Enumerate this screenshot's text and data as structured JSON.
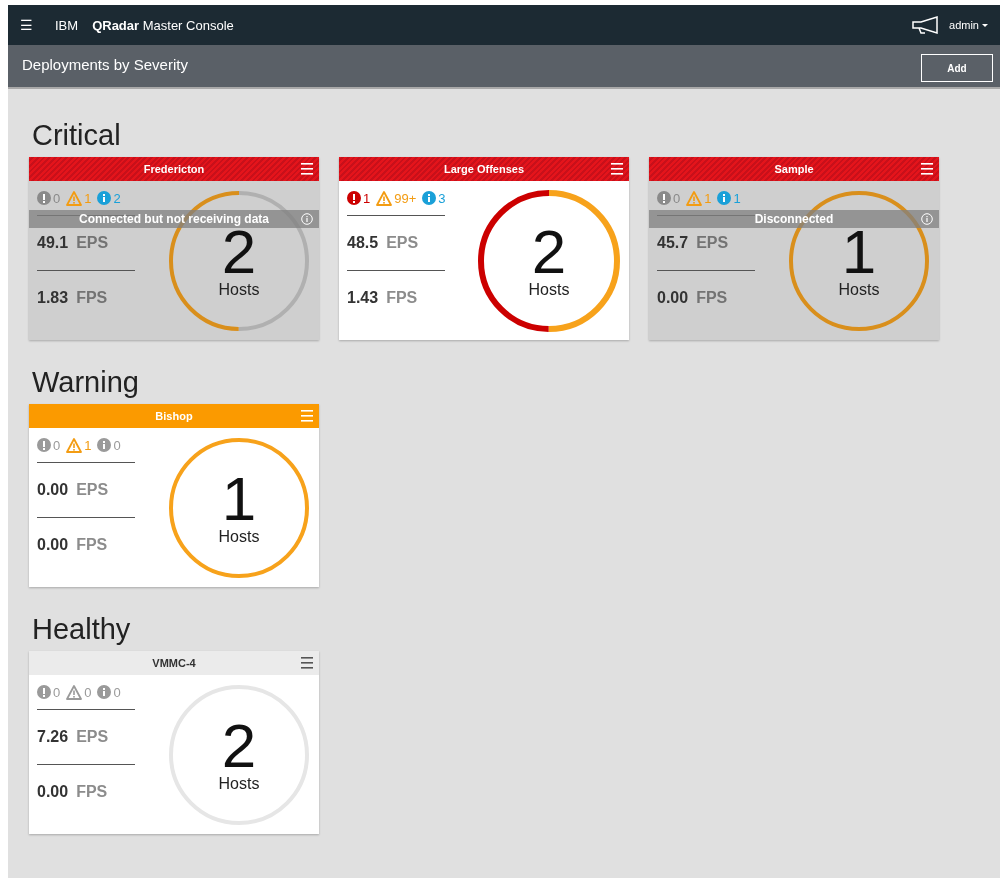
{
  "topbar": {
    "menu": "☰",
    "brand": "IBM",
    "product_bold": "QRadar",
    "product": "Master Console",
    "user": "admin"
  },
  "subheader": {
    "title": "Deployments by Severity",
    "button": "Add"
  },
  "sections": [
    {
      "title": "Critical",
      "deployments": [
        {
          "name": "Fredericton",
          "kind": "critical",
          "counts": [
            {
              "kind": "error",
              "value": "0",
              "active": false
            },
            {
              "kind": "warning",
              "value": "1",
              "active": true
            },
            {
              "kind": "info",
              "value": "2",
              "active": true
            }
          ],
          "status": "Connected but not receiving data",
          "eps": "49.1",
          "eps_label": "EPS",
          "fps": "1.83",
          "fps_label": "FPS",
          "hosts": "2",
          "hosts_label": "Hosts",
          "ring": [
            {
              "color": "#b0b0b0",
              "level": 0.5
            },
            {
              "color": "#d98f1c",
              "level": 0.5
            }
          ]
        },
        {
          "name": "Large Offenses",
          "kind": "critical",
          "counts": [
            {
              "kind": "error",
              "value": "1",
              "active": true
            },
            {
              "kind": "warning",
              "value": "99+",
              "active": true
            },
            {
              "kind": "info",
              "value": "3",
              "active": true
            }
          ],
          "eps": "48.5",
          "eps_label": "EPS",
          "fps": "1.43",
          "fps_label": "FPS",
          "hosts": "2",
          "hosts_label": "Hosts",
          "ring": [
            {
              "color": "#f7a21b",
              "level": 0.5
            },
            {
              "color": "#cc0000",
              "level": 0.5
            }
          ]
        },
        {
          "name": "Sample",
          "kind": "critical",
          "counts": [
            {
              "kind": "error",
              "value": "0",
              "active": false
            },
            {
              "kind": "warning",
              "value": "1",
              "active": true
            },
            {
              "kind": "info",
              "value": "1",
              "active": true
            }
          ],
          "status": "Disconnected",
          "eps": "45.7",
          "eps_label": "EPS",
          "fps": "0.00",
          "fps_label": "FPS",
          "hosts": "1",
          "hosts_label": "Hosts",
          "ring": [
            {
              "color": "#d98f1c",
              "level": 1
            }
          ]
        }
      ]
    },
    {
      "title": "Warning",
      "deployments": [
        {
          "name": "Bishop",
          "kind": "warning",
          "counts": [
            {
              "kind": "error",
              "value": "0",
              "active": false
            },
            {
              "kind": "warning",
              "value": "1",
              "active": true
            },
            {
              "kind": "info",
              "value": "0",
              "active": false
            }
          ],
          "eps": "0.00",
          "eps_label": "EPS",
          "fps": "0.00",
          "fps_label": "FPS",
          "hosts": "1",
          "hosts_label": "Hosts",
          "ring": [
            {
              "color": "#f7a21b",
              "level": 1
            }
          ]
        }
      ]
    },
    {
      "title": "Healthy",
      "deployments": [
        {
          "name": "VMMC-4",
          "kind": "healthy",
          "counts": [
            {
              "kind": "error",
              "value": "0",
              "active": false
            },
            {
              "kind": "warning",
              "value": "0",
              "active": false
            },
            {
              "kind": "info",
              "value": "0",
              "active": false
            }
          ],
          "eps": "7.26",
          "eps_label": "EPS",
          "fps": "0.00",
          "fps_label": "FPS",
          "hosts": "2",
          "hosts_label": "Hosts",
          "ring": [
            {
              "color": "#e6e6e6",
              "level": 1
            }
          ]
        }
      ]
    }
  ]
}
